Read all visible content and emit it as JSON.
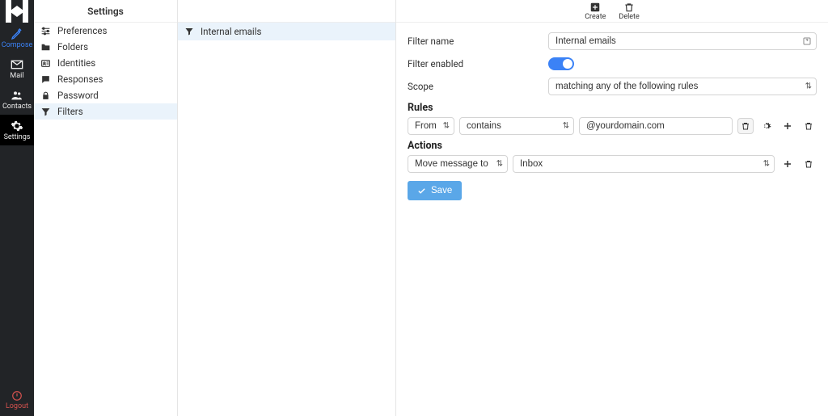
{
  "leftbar": {
    "compose": "Compose",
    "mail": "Mail",
    "contacts": "Contacts",
    "settings": "Settings",
    "logout": "Logout"
  },
  "columns": {
    "settings_header": "Settings"
  },
  "settings_items": {
    "preferences": "Preferences",
    "folders": "Folders",
    "identities": "Identities",
    "responses": "Responses",
    "password": "Password",
    "filters": "Filters"
  },
  "filters_list": {
    "item0": "Internal emails"
  },
  "toolbar": {
    "create": "Create",
    "delete": "Delete"
  },
  "form": {
    "filter_name_label": "Filter name",
    "filter_name_value": "Internal emails",
    "filter_enabled_label": "Filter enabled",
    "filter_enabled": true,
    "scope_label": "Scope",
    "scope_value": "matching any of the following rules",
    "rules_header": "Rules",
    "rule_field": "From",
    "rule_op": "contains",
    "rule_value": "@yourdomain.com",
    "actions_header": "Actions",
    "action_type": "Move message to",
    "action_target": "Inbox",
    "save_label": "Save"
  }
}
